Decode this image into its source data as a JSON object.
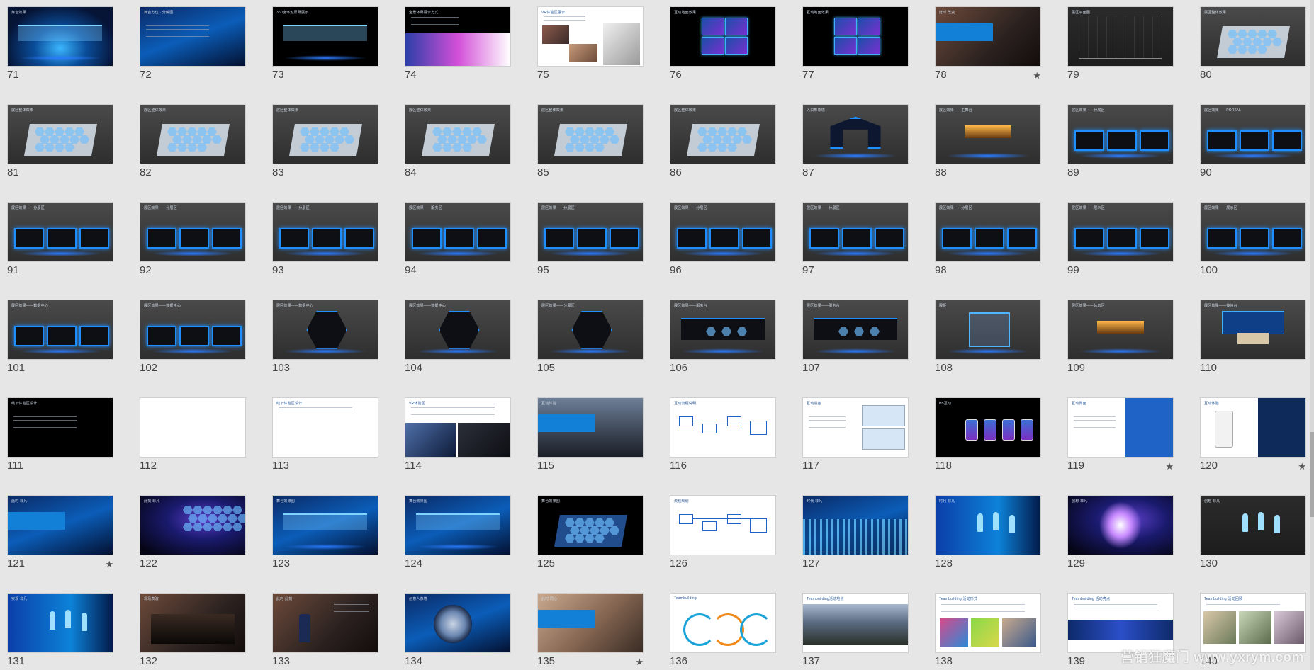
{
  "slides": [
    {
      "num": "71",
      "star": false,
      "theme": "b-stage",
      "kind": "stage",
      "cap": "舞台效果"
    },
    {
      "num": "72",
      "star": false,
      "theme": "b-blue",
      "kind": "text",
      "cap": "舞台方位 · 分解图"
    },
    {
      "num": "73",
      "star": false,
      "theme": "b-black",
      "kind": "stage",
      "cap": "360度环形屏幕展示"
    },
    {
      "num": "74",
      "star": false,
      "theme": "b-black",
      "kind": "imageright",
      "cap": "全景环幕展示方式"
    },
    {
      "num": "75",
      "star": false,
      "theme": "b-white",
      "kind": "photos",
      "cap": "VR体验区展示"
    },
    {
      "num": "76",
      "star": false,
      "theme": "b-black",
      "kind": "screens",
      "cap": "互动地面效果"
    },
    {
      "num": "77",
      "star": false,
      "theme": "b-black",
      "kind": "screens",
      "cap": "互动地面效果"
    },
    {
      "num": "78",
      "star": true,
      "theme": "b-photo",
      "kind": "bluebar",
      "cap": "此时 改变"
    },
    {
      "num": "79",
      "star": false,
      "theme": "b-dark",
      "kind": "plan",
      "cap": "展区平面图"
    },
    {
      "num": "80",
      "star": false,
      "theme": "b-grey",
      "kind": "hexfloor",
      "cap": "展区整体效果"
    },
    {
      "num": "81",
      "star": false,
      "theme": "b-grey",
      "kind": "hexfloor",
      "cap": "展区整体效果"
    },
    {
      "num": "82",
      "star": false,
      "theme": "b-grey",
      "kind": "hexfloor",
      "cap": "展区整体效果"
    },
    {
      "num": "83",
      "star": false,
      "theme": "b-grey",
      "kind": "hexfloor",
      "cap": "展区整体效果"
    },
    {
      "num": "84",
      "star": false,
      "theme": "b-grey",
      "kind": "hexfloor",
      "cap": "展区整体效果"
    },
    {
      "num": "85",
      "star": false,
      "theme": "b-grey",
      "kind": "hexfloor",
      "cap": "展区整体效果"
    },
    {
      "num": "86",
      "star": false,
      "theme": "b-grey",
      "kind": "hexfloor",
      "cap": "展区整体效果"
    },
    {
      "num": "87",
      "star": false,
      "theme": "b-grey",
      "kind": "gate",
      "cap": "入口形象墙"
    },
    {
      "num": "88",
      "star": false,
      "theme": "b-grey",
      "kind": "stagebox",
      "cap": "展区效果——主舞台"
    },
    {
      "num": "89",
      "star": false,
      "theme": "b-grey",
      "kind": "booths",
      "cap": "展区效果——分展区"
    },
    {
      "num": "90",
      "star": false,
      "theme": "b-grey",
      "kind": "booths",
      "cap": "展区效果——PORTAL"
    },
    {
      "num": "91",
      "star": false,
      "theme": "b-grey",
      "kind": "booths",
      "cap": "展区效果——分展区"
    },
    {
      "num": "92",
      "star": false,
      "theme": "b-grey",
      "kind": "booths",
      "cap": "展区效果——分展区"
    },
    {
      "num": "93",
      "star": false,
      "theme": "b-grey",
      "kind": "booths",
      "cap": "展区效果——分展区"
    },
    {
      "num": "94",
      "star": false,
      "theme": "b-grey",
      "kind": "booths",
      "cap": "展区效果——服务区"
    },
    {
      "num": "95",
      "star": false,
      "theme": "b-grey",
      "kind": "booths",
      "cap": "展区效果——分展区"
    },
    {
      "num": "96",
      "star": false,
      "theme": "b-grey",
      "kind": "booths",
      "cap": "展区效果——分展区"
    },
    {
      "num": "97",
      "star": false,
      "theme": "b-grey",
      "kind": "booths",
      "cap": "展区效果——分展区"
    },
    {
      "num": "98",
      "star": false,
      "theme": "b-grey",
      "kind": "booths",
      "cap": "展区效果——分展区"
    },
    {
      "num": "99",
      "star": false,
      "theme": "b-grey",
      "kind": "booths",
      "cap": "展区效果——展示区"
    },
    {
      "num": "100",
      "star": false,
      "theme": "b-grey",
      "kind": "booths",
      "cap": "展区效果——展示区"
    },
    {
      "num": "101",
      "star": false,
      "theme": "b-grey",
      "kind": "booths",
      "cap": "展区效果——数据中心"
    },
    {
      "num": "102",
      "star": false,
      "theme": "b-grey",
      "kind": "booths",
      "cap": "展区效果——数据中心"
    },
    {
      "num": "103",
      "star": false,
      "theme": "b-grey",
      "kind": "hexbooth",
      "cap": "展区效果——数据中心"
    },
    {
      "num": "104",
      "star": false,
      "theme": "b-grey",
      "kind": "hexbooth",
      "cap": "展区效果——数据中心"
    },
    {
      "num": "105",
      "star": false,
      "theme": "b-grey",
      "kind": "hexbooth",
      "cap": "展区效果——分展区"
    },
    {
      "num": "106",
      "star": false,
      "theme": "b-grey",
      "kind": "hexwall",
      "cap": "展区效果——服务台"
    },
    {
      "num": "107",
      "star": false,
      "theme": "b-grey",
      "kind": "hexwall",
      "cap": "展区效果——服务台"
    },
    {
      "num": "108",
      "star": false,
      "theme": "b-grey",
      "kind": "glassbox",
      "cap": "展柜"
    },
    {
      "num": "109",
      "star": false,
      "theme": "b-grey",
      "kind": "stagebox",
      "cap": "展区效果——休息区"
    },
    {
      "num": "110",
      "star": false,
      "theme": "b-grey",
      "kind": "counter",
      "cap": "展区效果——接待台"
    },
    {
      "num": "111",
      "star": false,
      "theme": "b-black",
      "kind": "text",
      "cap": "线下体验区设计"
    },
    {
      "num": "112",
      "star": false,
      "theme": "b-white",
      "kind": "blank",
      "cap": ""
    },
    {
      "num": "113",
      "star": false,
      "theme": "b-white",
      "kind": "doc",
      "cap": "线下体验区设计"
    },
    {
      "num": "114",
      "star": false,
      "theme": "b-white",
      "kind": "docimg",
      "cap": "VR体验区"
    },
    {
      "num": "115",
      "star": false,
      "theme": "b-sky",
      "kind": "bluebar",
      "cap": "互动体验"
    },
    {
      "num": "116",
      "star": false,
      "theme": "b-white",
      "kind": "flow",
      "cap": "互动流程说明"
    },
    {
      "num": "117",
      "star": false,
      "theme": "b-white",
      "kind": "devices",
      "cap": "互动设备"
    },
    {
      "num": "118",
      "star": false,
      "theme": "b-black",
      "kind": "phones",
      "cap": "H5互动"
    },
    {
      "num": "119",
      "star": true,
      "theme": "b-white",
      "kind": "split",
      "cap": "互动界面"
    },
    {
      "num": "120",
      "star": true,
      "theme": "b-white",
      "kind": "splitdark",
      "cap": "互动体验"
    },
    {
      "num": "121",
      "star": true,
      "theme": "b-blue",
      "kind": "bluebar",
      "cap": "此时 非凡"
    },
    {
      "num": "122",
      "star": false,
      "theme": "b-galaxy",
      "kind": "hexnet",
      "cap": "此刻 非凡"
    },
    {
      "num": "123",
      "star": false,
      "theme": "b-blue",
      "kind": "stage",
      "cap": "舞台效果图"
    },
    {
      "num": "124",
      "star": false,
      "theme": "b-blue",
      "kind": "stage",
      "cap": "舞台效果图"
    },
    {
      "num": "125",
      "star": false,
      "theme": "b-black",
      "kind": "hexfloorblue",
      "cap": "舞台效果图"
    },
    {
      "num": "126",
      "star": false,
      "theme": "b-white",
      "kind": "flow",
      "cap": "流程规划"
    },
    {
      "num": "127",
      "star": false,
      "theme": "b-blue",
      "kind": "crowd",
      "cap": "时代 非凡"
    },
    {
      "num": "128",
      "star": false,
      "theme": "b-cyan",
      "kind": "dancers",
      "cap": "时代 非凡"
    },
    {
      "num": "129",
      "star": false,
      "theme": "b-galaxy",
      "kind": "butterfly",
      "cap": "创想 非凡"
    },
    {
      "num": "130",
      "star": false,
      "theme": "b-dark",
      "kind": "dancers",
      "cap": "创想 非凡"
    },
    {
      "num": "131",
      "star": false,
      "theme": "b-cyan",
      "kind": "dancers",
      "cap": "实现 非凡"
    },
    {
      "num": "132",
      "star": false,
      "theme": "b-photo",
      "kind": "band",
      "cap": "现场表演"
    },
    {
      "num": "133",
      "star": false,
      "theme": "b-photo",
      "kind": "speaker",
      "cap": "此时 此刻"
    },
    {
      "num": "134",
      "star": false,
      "theme": "b-blue",
      "kind": "globe",
      "cap": "创意人像墙"
    },
    {
      "num": "135",
      "star": true,
      "theme": "b-hands",
      "kind": "bluebar",
      "cap": "此时 同心"
    },
    {
      "num": "136",
      "star": false,
      "theme": "b-white",
      "kind": "diagram",
      "cap": "Teambuilding"
    },
    {
      "num": "137",
      "star": false,
      "theme": "b-white",
      "kind": "landscape",
      "cap": "Teambuilding活动地点"
    },
    {
      "num": "138",
      "star": false,
      "theme": "b-white",
      "kind": "gallery",
      "cap": "Teambuilding 活动形式"
    },
    {
      "num": "139",
      "star": false,
      "theme": "b-white",
      "kind": "bannerdoc",
      "cap": "Teambuilding 活动亮点"
    },
    {
      "num": "140",
      "star": false,
      "theme": "b-white",
      "kind": "photorow",
      "cap": "Teambuilding 活动回顾"
    }
  ],
  "watermark": "营销狂魔门 www.yxrym.com",
  "icons": {
    "star": "star-icon"
  }
}
